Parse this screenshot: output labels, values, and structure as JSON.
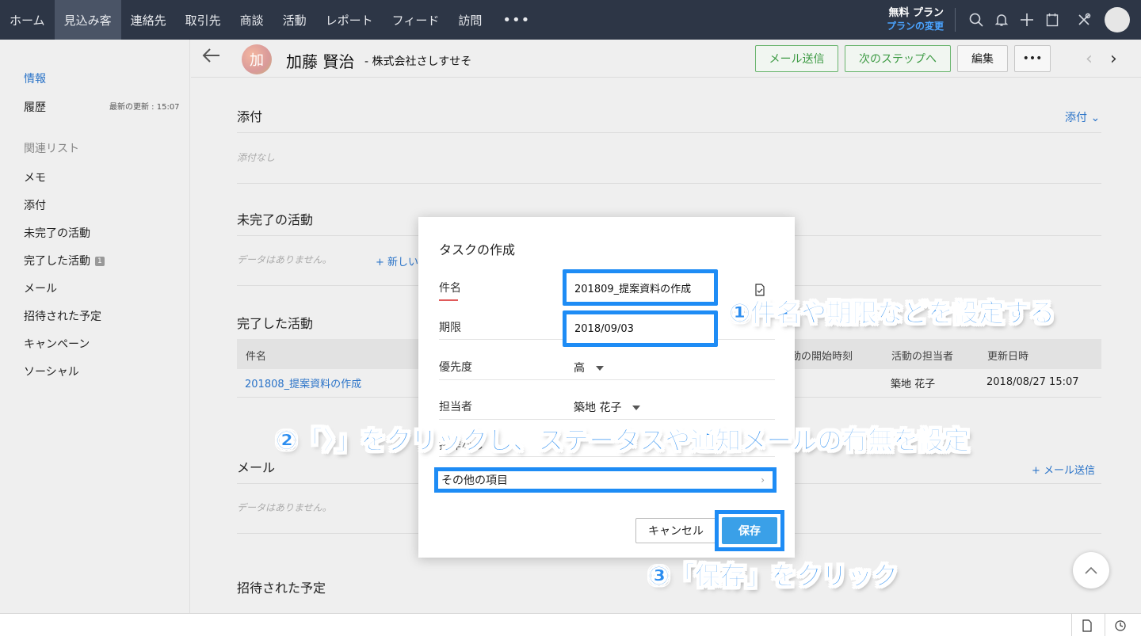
{
  "nav": {
    "tabs": [
      "ホーム",
      "見込み客",
      "連絡先",
      "取引先",
      "商談",
      "活動",
      "レポート",
      "フィード",
      "訪問"
    ],
    "more": "•••",
    "plan_line1": "無料 プラン",
    "plan_line2": "プランの変更",
    "icons": [
      "search-icon",
      "bell-icon",
      "plus-icon",
      "calendar-icon",
      "tools-icon",
      "avatar"
    ]
  },
  "sidebar": {
    "info": "情報",
    "history": "履歴",
    "last_updated": "最新の更新 : 15:07",
    "related_list": "関連リスト",
    "items": [
      "メモ",
      "添付",
      "未完了の活動",
      "完了した活動",
      "メール",
      "招待された予定",
      "キャンペーン",
      "ソーシャル"
    ],
    "completed_badge": "1"
  },
  "record": {
    "avatar_char": "加",
    "name": "加藤 賢治",
    "company": "- 株式会社さしすせそ",
    "btn_email": "メール送信",
    "btn_next_step": "次のステップへ",
    "btn_edit": "編集",
    "btn_more": "•••"
  },
  "main": {
    "attach_title": "添付",
    "attach_link": "添付 ⌄",
    "attach_empty": "添付なし",
    "open_title": "未完了の活動",
    "open_empty": "データはありません。",
    "open_new": "+ 新しい",
    "done_title": "完了した活動",
    "done_cols": [
      "件名",
      "活動の開始時刻",
      "活動の担当者",
      "更新日時"
    ],
    "done_rows": [
      {
        "subject": "201808_提案資料の作成",
        "owner": "築地 花子",
        "updated": "2018/08/27 15:07"
      }
    ],
    "mail_title": "メール",
    "mail_empty": "データはありません。",
    "mail_send": "+ メール送信",
    "invited_title": "招待された予定"
  },
  "modal": {
    "title": "タスクの作成",
    "subject_label": "件名",
    "subject_value": "201809_提案資料の作成",
    "due_label": "期限",
    "due_value": "2018/09/03",
    "priority_label": "優先度",
    "priority_value": "高",
    "owner_label": "担当者",
    "owner_value": "築地 花子",
    "related_partial": "操作なし",
    "more_items": "その他の項目",
    "cancel": "キャンセル",
    "save": "保存"
  },
  "annotations": {
    "a1": "①件名や期限などを設定する",
    "a2": "②「〉」をクリックし、ステータスや通知メールの有無を設定",
    "a3": "③「保存」をクリック"
  },
  "colors": {
    "nav_bg": "#2d3646",
    "accent_blue": "#1e8cf5",
    "link_blue": "#2a73c8",
    "green": "#3c9a43",
    "save_blue": "#3aa0e8"
  }
}
